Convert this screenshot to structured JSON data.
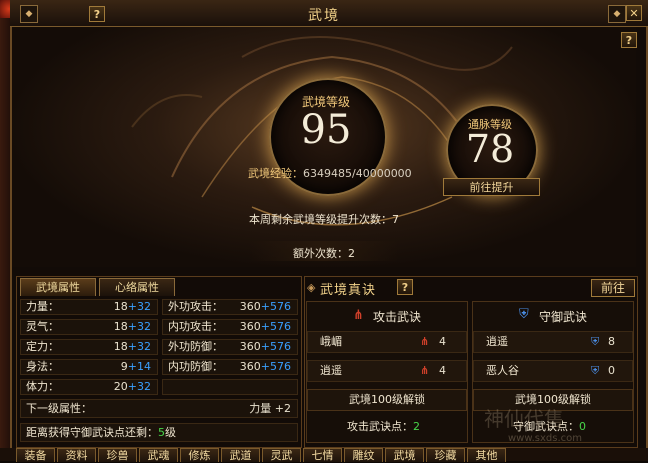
{
  "window": {
    "title": "武境",
    "help": "?",
    "close": "✕"
  },
  "hero": {
    "wujing_label": "武境等级",
    "wujing_level": "95",
    "tongmai_label": "通脉等级",
    "tongmai_level": "78",
    "exp_label": "武境经验：",
    "exp_value": "6349485/40000000",
    "goto_button": "前往提升",
    "weekly_text": "本周剩余武境等级提升次数：7",
    "extra_text": "额外次数：2"
  },
  "left_panel": {
    "tabs": [
      "武境属性",
      "心络属性"
    ],
    "rows": [
      {
        "l_label": "力量：",
        "l_base": "18",
        "l_bonus": "+32",
        "r_label": "外功攻击：",
        "r_base": "360",
        "r_bonus": "+576"
      },
      {
        "l_label": "灵气：",
        "l_base": "18",
        "l_bonus": "+32",
        "r_label": "内功攻击：",
        "r_base": "360",
        "r_bonus": "+576"
      },
      {
        "l_label": "定力：",
        "l_base": "18",
        "l_bonus": "+32",
        "r_label": "外功防御：",
        "r_base": "360",
        "r_bonus": "+576"
      },
      {
        "l_label": "身法：",
        "l_base": "9",
        "l_bonus": "+14",
        "r_label": "内功防御：",
        "r_base": "360",
        "r_bonus": "+576"
      },
      {
        "l_label": "体力：",
        "l_base": "20",
        "l_bonus": "+32",
        "r_label": "",
        "r_base": "",
        "r_bonus": ""
      }
    ],
    "next_label": "下一级属性：",
    "next_value": "力量 +2",
    "dist_label": "距离获得守御武诀点还剩：",
    "dist_value": "5",
    "dist_unit": "级"
  },
  "right_panel": {
    "title": "武境真诀",
    "help": "?",
    "prev_button": "前往",
    "attack": {
      "title": "攻击武诀",
      "items": [
        {
          "name": "峨嵋",
          "count": "4"
        },
        {
          "name": "逍遥",
          "count": "4"
        }
      ],
      "unlock": "武境100级解锁",
      "points_label": "攻击武诀点：",
      "points_value": "2"
    },
    "defense": {
      "title": "守御武诀",
      "items": [
        {
          "name": "逍遥",
          "count": "8"
        },
        {
          "name": "恶人谷",
          "count": "0"
        }
      ],
      "unlock": "武境100级解锁",
      "points_label": "守御武诀点：",
      "points_value": "0"
    }
  },
  "bottom_tabs": [
    "装备",
    "资料",
    "珍兽",
    "武魂",
    "修炼",
    "武道",
    "灵武",
    "七情",
    "雕纹",
    "武境",
    "珍藏",
    "其他"
  ],
  "watermark": {
    "text": "神仙代售",
    "url": "www.sxds.com"
  },
  "colors": {
    "gold": "#f0c77a",
    "blue_bonus": "#3aa0ff",
    "green": "#47d44a",
    "attack_icon": "#d0402a",
    "defense_icon": "#4a8ee6"
  }
}
